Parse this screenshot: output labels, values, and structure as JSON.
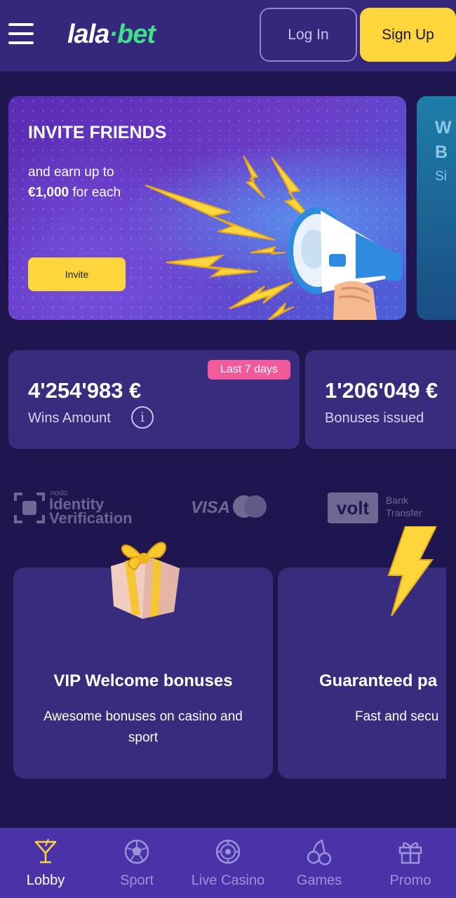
{
  "header": {
    "logo_main": "lala",
    "logo_dot": "·",
    "logo_accent": "bet",
    "login_label": "Log In",
    "signup_label": "Sign Up"
  },
  "banner": {
    "title": "INVITE FRIENDS",
    "text_line1": "and earn up to",
    "text_amount": "€1,000",
    "text_line2_rest": " for each",
    "button_label": "Invite",
    "next_banner_letters": [
      "W",
      "B"
    ],
    "next_banner_text": "Si"
  },
  "stats": {
    "badge": "Last 7 days",
    "items": [
      {
        "value": "4'254'983 €",
        "label": "Wins Amount"
      },
      {
        "value": "1'206'049 €",
        "label": "Bonuses issued"
      }
    ]
  },
  "partners": {
    "nodo_small": "nodo",
    "nodo_line1": "Identity",
    "nodo_line2": "Verification",
    "visa": "VISA",
    "volt": "volt",
    "bank_line1": "Bank",
    "bank_line2": "Transfer"
  },
  "features": [
    {
      "title": "VIP Welcome bonuses",
      "desc": "Awesome bonuses on casino and sport",
      "icon": "gift-icon"
    },
    {
      "title": "Guaranteed pa",
      "desc": "Fast and secu",
      "icon": "lightning-icon"
    }
  ],
  "bottom_nav": [
    {
      "label": "Lobby",
      "icon": "cocktail-icon",
      "active": true
    },
    {
      "label": "Sport",
      "icon": "soccer-ball-icon",
      "active": false
    },
    {
      "label": "Live Casino",
      "icon": "roulette-icon",
      "active": false
    },
    {
      "label": "Games",
      "icon": "cherries-icon",
      "active": false
    },
    {
      "label": "Promo",
      "icon": "gift-outline-icon",
      "active": false
    }
  ],
  "colors": {
    "background": "#1f1650",
    "header": "#34277c",
    "card": "#382c7e",
    "accent_yellow": "#fcd63a",
    "brand_green": "#3fe08a",
    "badge_pink": "#f25a9a",
    "nav_bg": "#4a33a8"
  }
}
